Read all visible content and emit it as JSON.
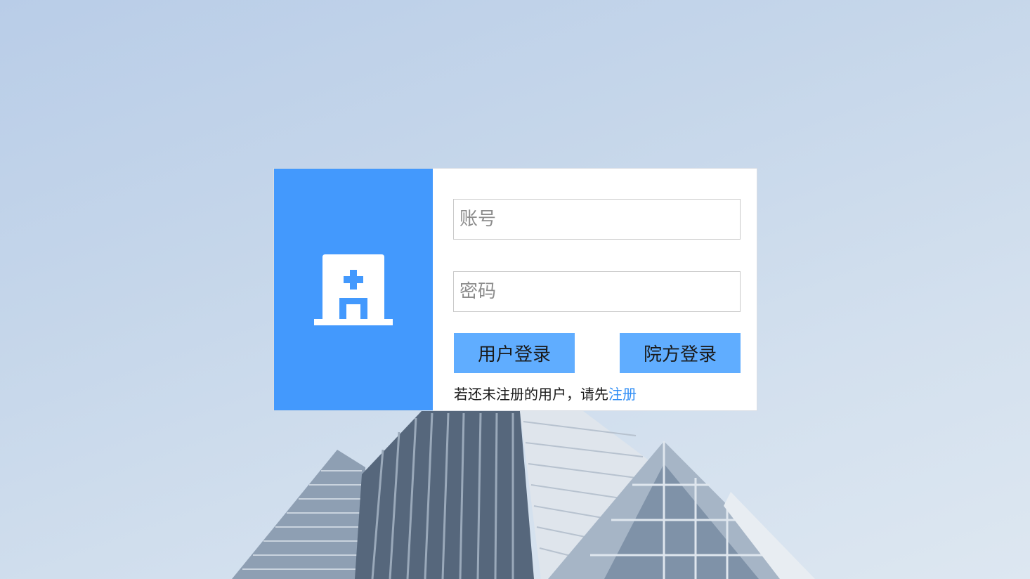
{
  "login": {
    "account_placeholder": "账号",
    "password_placeholder": "密码",
    "user_login_label": "用户登录",
    "hospital_login_label": "院方登录",
    "register_prompt": "若还未注册的用户，请先",
    "register_link": "注册"
  },
  "icons": {
    "logo": "hospital-icon"
  },
  "colors": {
    "accent": "#4399fd",
    "button": "#60adff",
    "link": "#2f8df5"
  }
}
